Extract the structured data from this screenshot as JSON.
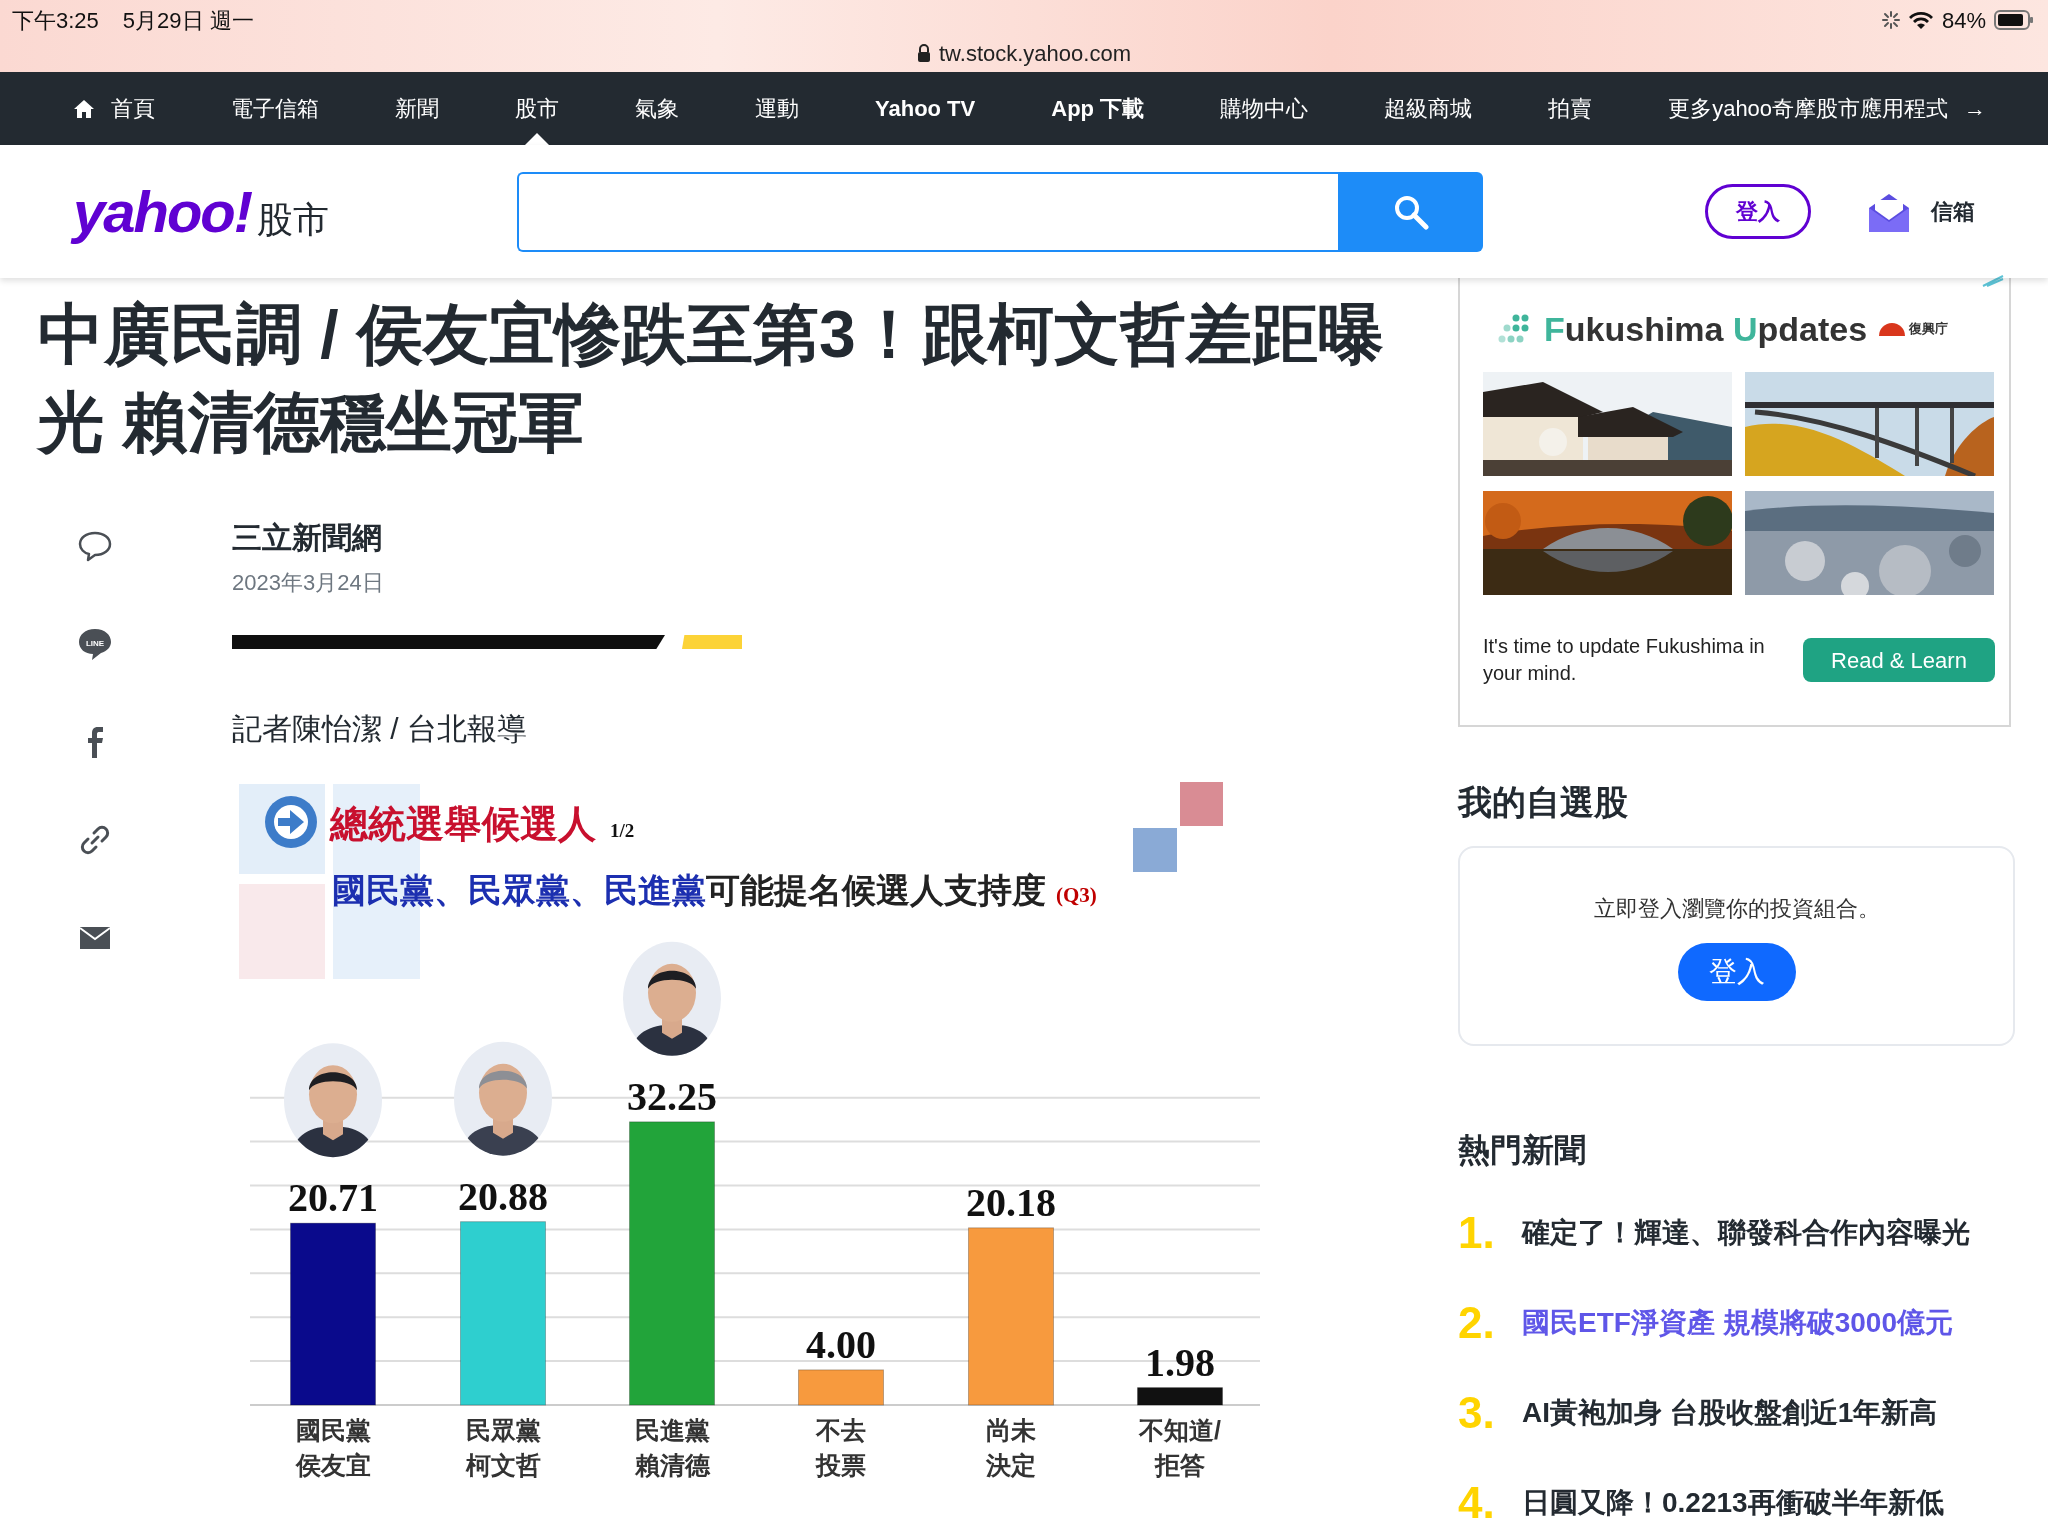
{
  "status_bar": {
    "time": "下午3:25",
    "date": "5月29日 週一",
    "url": "tw.stock.yahoo.com",
    "battery": "84%"
  },
  "nav": {
    "items": [
      {
        "label": "首頁",
        "kind": "home",
        "bold": false,
        "selected": false
      },
      {
        "label": "電子信箱",
        "kind": "link",
        "bold": false,
        "selected": false
      },
      {
        "label": "新聞",
        "kind": "link",
        "bold": false,
        "selected": false
      },
      {
        "label": "股市",
        "kind": "link",
        "bold": false,
        "selected": true
      },
      {
        "label": "氣象",
        "kind": "link",
        "bold": false,
        "selected": false
      },
      {
        "label": "運動",
        "kind": "link",
        "bold": false,
        "selected": false
      },
      {
        "label": "Yahoo TV",
        "kind": "link",
        "bold": true,
        "selected": false
      },
      {
        "label": "App 下載",
        "kind": "link",
        "bold": true,
        "selected": false
      },
      {
        "label": "購物中心",
        "kind": "link",
        "bold": false,
        "selected": false
      },
      {
        "label": "超級商城",
        "kind": "link",
        "bold": false,
        "selected": false
      },
      {
        "label": "拍賣",
        "kind": "link",
        "bold": false,
        "selected": false
      },
      {
        "label": "更多yahoo奇摩股市應用程式",
        "kind": "more",
        "bold": false,
        "selected": false
      }
    ],
    "more_arrow": "→"
  },
  "header": {
    "logo": "yahoo!",
    "section": "股市",
    "login": "登入",
    "mail": "信箱"
  },
  "article": {
    "title": "中廣民調 / 侯友宜慘跌至第3！跟柯文哲差距曝光 賴清德穩坐冠軍",
    "share": {
      "line_label": "LINE"
    },
    "source": "三立新聞網",
    "date": "2023年3月24日",
    "reporter": "記者陳怡潔 / 台北報導",
    "graphic": {
      "page": "1/2",
      "question": "(Q3)",
      "subtitle_parts": [
        {
          "text": "國民黨、民眾黨、民進黨",
          "color": "#1c2fb0"
        },
        {
          "text": "可能提名候選人支持度",
          "color": "#222222"
        }
      ],
      "portraits": [
        true,
        true,
        true,
        false,
        false,
        false
      ],
      "chart_data": {
        "type": "bar",
        "title": "總統選舉候選人",
        "categories": [
          "國民黨侯友宜",
          "民眾黨柯文哲",
          "民進黨賴清德",
          "不去投票",
          "尚未決定",
          "不知道/拒答"
        ],
        "values": [
          20.71,
          20.88,
          32.25,
          4.0,
          20.18,
          1.98
        ],
        "value_labels": [
          "20.71",
          "20.88",
          "32.25",
          "4.00",
          "20.18",
          "1.98"
        ],
        "colors": [
          "#0a0a8c",
          "#2ecfcf",
          "#22a43a",
          "#f79a3e",
          "#f79a3e",
          "#111111"
        ],
        "data_labels": true
      }
    }
  },
  "sidebar": {
    "ad": {
      "title_parts": [
        {
          "text": "F",
          "color": "#3fb59b"
        },
        {
          "text": "ukushima ",
          "color": "#333333"
        },
        {
          "text": "U",
          "color": "#3fb59b"
        },
        {
          "text": "pdates",
          "color": "#333333"
        }
      ],
      "agency": "復興庁",
      "text": "It's time to update Fukushima in your mind.",
      "button": "Read & Learn"
    },
    "watchlist": {
      "title": "我的自選股",
      "message": "立即登入瀏覽你的投資組合。",
      "button": "登入"
    },
    "trending": {
      "title": "熱門新聞",
      "items": [
        {
          "number": "1.",
          "text": "確定了！輝達、聯發科合作內容曝光",
          "highlighted": false
        },
        {
          "number": "2.",
          "text": "國民ETF淨資產 規模將破3000億元",
          "highlighted": true
        },
        {
          "number": "3.",
          "text": "AI黃袍加身 台股收盤創近1年新高",
          "highlighted": false
        },
        {
          "number": "4.",
          "text": "日圓又降！0.2213再衝破半年新低",
          "highlighted": false
        }
      ]
    }
  }
}
